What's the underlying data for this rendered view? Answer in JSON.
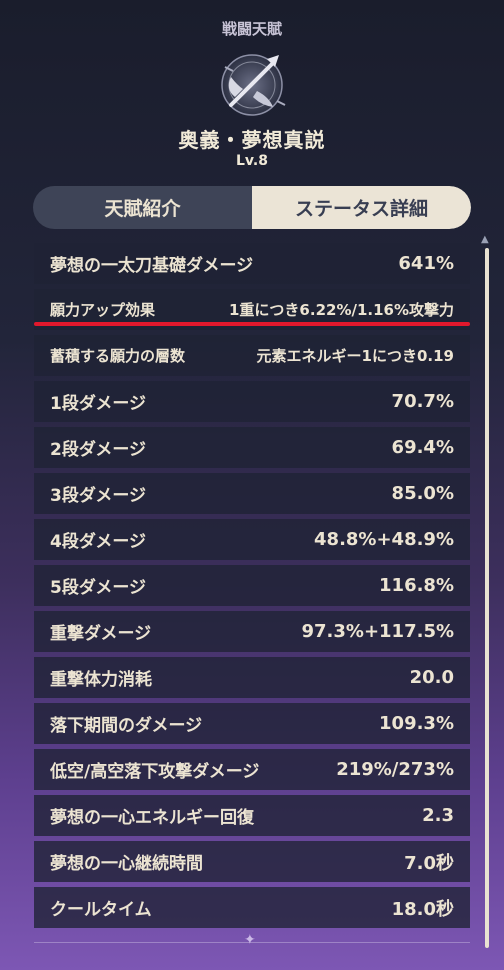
{
  "header": {
    "category": "戦闘天賦",
    "emblem_icon": "polearm-crest-icon",
    "talent_name": "奥義・夢想真説",
    "level": "Lv.8"
  },
  "tabs": [
    {
      "label": "天賦紹介",
      "active": false
    },
    {
      "label": "ステータス詳細",
      "active": true
    }
  ],
  "stats": [
    {
      "label": "夢想の一太刀基礎ダメージ",
      "value": "641%"
    },
    {
      "label": "願力アップ効果",
      "value": "1重につき6.22%/1.16%攻撃力"
    },
    {
      "label": "蓄積する願力の層数",
      "value": "元素エネルギー1につき0.19"
    },
    {
      "label": "1段ダメージ",
      "value": "70.7%"
    },
    {
      "label": "2段ダメージ",
      "value": "69.4%"
    },
    {
      "label": "3段ダメージ",
      "value": "85.0%"
    },
    {
      "label": "4段ダメージ",
      "value": "48.8%+48.9%"
    },
    {
      "label": "5段ダメージ",
      "value": "116.8%"
    },
    {
      "label": "重撃ダメージ",
      "value": "97.3%+117.5%"
    },
    {
      "label": "重撃体力消耗",
      "value": "20.0"
    },
    {
      "label": "落下期間のダメージ",
      "value": "109.3%"
    },
    {
      "label": "低空/高空落下攻撃ダメージ",
      "value": "219%/273%"
    },
    {
      "label": "夢想の一心エネルギー回復",
      "value": "2.3"
    },
    {
      "label": "夢想の一心継続時間",
      "value": "7.0秒"
    },
    {
      "label": "クールタイム",
      "value": "18.0秒"
    }
  ],
  "colors": {
    "highlight": "#e1182c",
    "text": "#ece4d2",
    "active_tab": "#ebe4d6"
  }
}
